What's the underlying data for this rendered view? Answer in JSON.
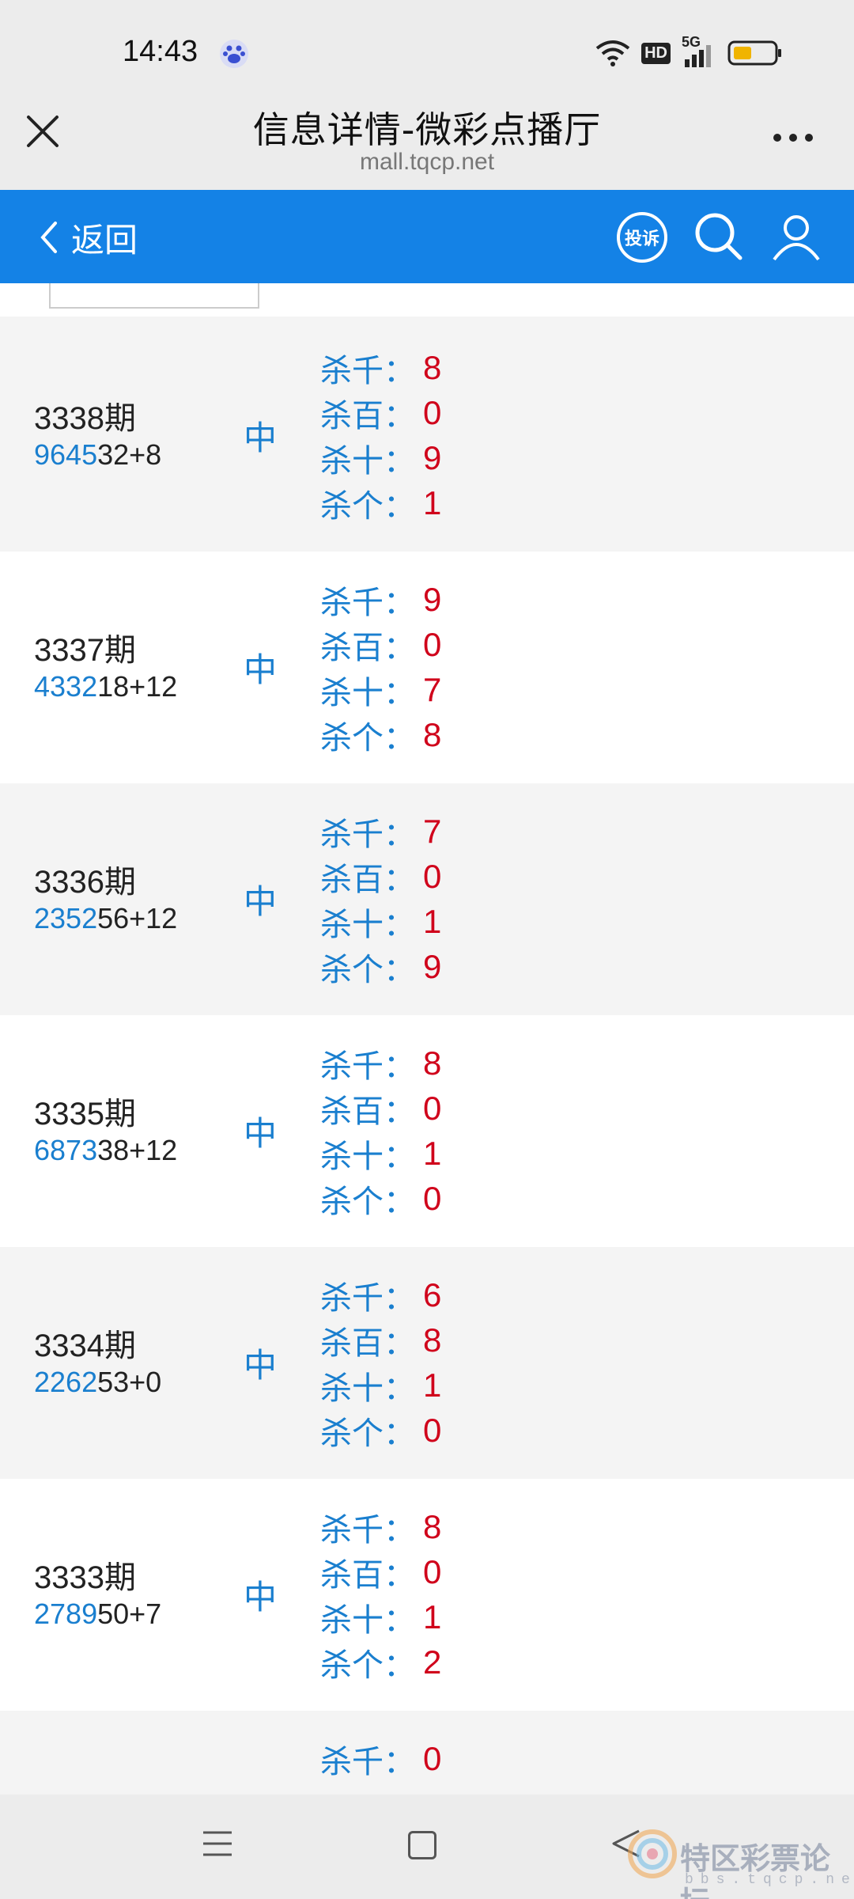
{
  "status": {
    "time": "14:43",
    "network": "5G",
    "hd": "HD"
  },
  "header": {
    "title": "信息详情-微彩点播厅",
    "url": "mall.tqcp.net"
  },
  "nav": {
    "back_label": "返回",
    "complain_label": "投诉"
  },
  "rows": [
    {
      "period": "3338期",
      "num_hl": "9645",
      "num_rest": "32+8",
      "hit": "中",
      "kills": [
        {
          "label": "杀千：",
          "value": "8"
        },
        {
          "label": "杀百：",
          "value": "0"
        },
        {
          "label": "杀十：",
          "value": "9"
        },
        {
          "label": "杀个：",
          "value": "1"
        }
      ]
    },
    {
      "period": "3337期",
      "num_hl": "4332",
      "num_rest": "18+12",
      "hit": "中",
      "kills": [
        {
          "label": "杀千：",
          "value": "9"
        },
        {
          "label": "杀百：",
          "value": "0"
        },
        {
          "label": "杀十：",
          "value": "7"
        },
        {
          "label": "杀个：",
          "value": "8"
        }
      ]
    },
    {
      "period": "3336期",
      "num_hl": "2352",
      "num_rest": "56+12",
      "hit": "中",
      "kills": [
        {
          "label": "杀千：",
          "value": "7"
        },
        {
          "label": "杀百：",
          "value": "0"
        },
        {
          "label": "杀十：",
          "value": "1"
        },
        {
          "label": "杀个：",
          "value": "9"
        }
      ]
    },
    {
      "period": "3335期",
      "num_hl": "6873",
      "num_rest": "38+12",
      "hit": "中",
      "kills": [
        {
          "label": "杀千：",
          "value": "8"
        },
        {
          "label": "杀百：",
          "value": "0"
        },
        {
          "label": "杀十：",
          "value": "1"
        },
        {
          "label": "杀个：",
          "value": "0"
        }
      ]
    },
    {
      "period": "3334期",
      "num_hl": "2262",
      "num_rest": "53+0",
      "hit": "中",
      "kills": [
        {
          "label": "杀千：",
          "value": "6"
        },
        {
          "label": "杀百：",
          "value": "8"
        },
        {
          "label": "杀十：",
          "value": "1"
        },
        {
          "label": "杀个：",
          "value": "0"
        }
      ]
    },
    {
      "period": "3333期",
      "num_hl": "2789",
      "num_rest": "50+7",
      "hit": "中",
      "kills": [
        {
          "label": "杀千：",
          "value": "8"
        },
        {
          "label": "杀百：",
          "value": "0"
        },
        {
          "label": "杀十：",
          "value": "1"
        },
        {
          "label": "杀个：",
          "value": "2"
        }
      ]
    }
  ],
  "partial_row": {
    "kill_label": "杀千：",
    "kill_value": "0"
  },
  "watermark": {
    "text": "特区彩票论坛",
    "sub": "bbs.tqcp.net"
  },
  "colors": {
    "nav_blue": "#1482e6",
    "highlight_blue": "#1a7fcf",
    "value_red": "#d0021b"
  }
}
